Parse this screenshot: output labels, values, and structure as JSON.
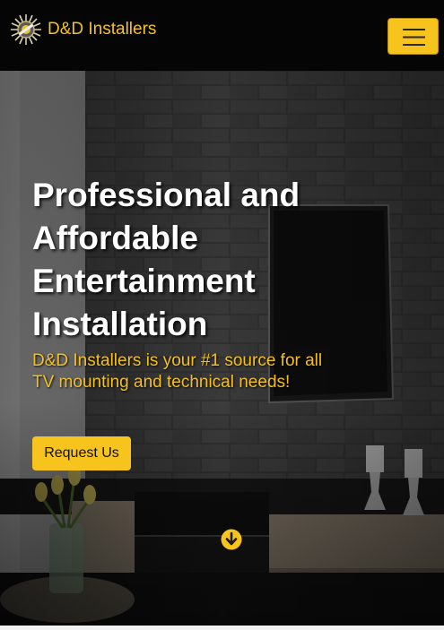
{
  "navbar": {
    "brand_name": "D&D Installers",
    "logo_icon": "tools-logo-icon",
    "menu_icon": "hamburger-menu-icon"
  },
  "hero": {
    "title": "Professional and Affordable Entertainment Installation",
    "subtitle": "D&D Installers is your #1 source for all TV mounting and technical needs!",
    "cta_label": "Request Us",
    "scroll_icon": "arrow-down-circle-icon",
    "background": "living-room-tv-brick-wall-photo"
  },
  "colors": {
    "accent": "#f7c31d",
    "navbar_bg": "#050505",
    "title_text": "#ffffff",
    "subtitle_text": "#f4c01e"
  }
}
